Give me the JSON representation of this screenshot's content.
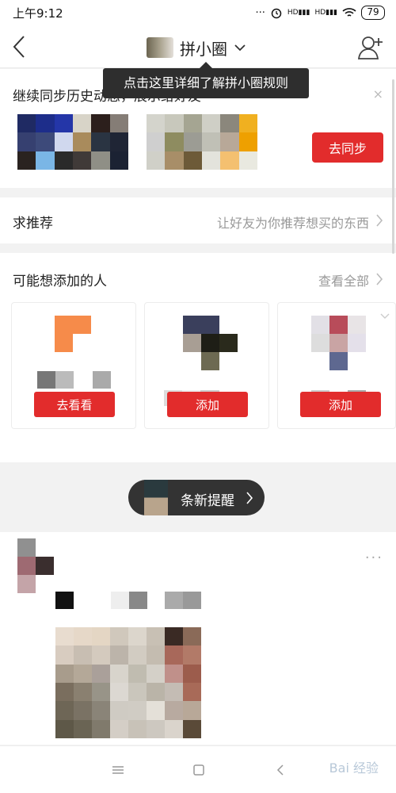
{
  "status_bar": {
    "time": "上午9:12",
    "signal1": "HD",
    "signal2": "HD",
    "battery": "79"
  },
  "header": {
    "title": "拼小圈",
    "icons": [
      "back-arrow-icon",
      "chevron-down-icon",
      "add-user-icon"
    ]
  },
  "tooltip": {
    "text": "点击这里详细了解拼小圈规则"
  },
  "sync": {
    "title": "继续同步历史动态，展示给好友",
    "button": "去同步",
    "close": "×"
  },
  "recommend": {
    "title": "求推荐",
    "subtitle": "让好友为你推荐想买的东西"
  },
  "people": {
    "title": "可能想添加的人",
    "view_all": "查看全部",
    "cards": [
      {
        "button": "去看看"
      },
      {
        "button": "添加"
      },
      {
        "button": "添加"
      }
    ]
  },
  "reminder": {
    "text": "条新提醒"
  },
  "feed": {
    "more": "···"
  },
  "nav": {
    "watermark": "Bai 经验"
  },
  "colors": {
    "accent_red": "#e22c2c",
    "tooltip_bg": "#2e2e2e",
    "reminder_bg": "#333333"
  }
}
